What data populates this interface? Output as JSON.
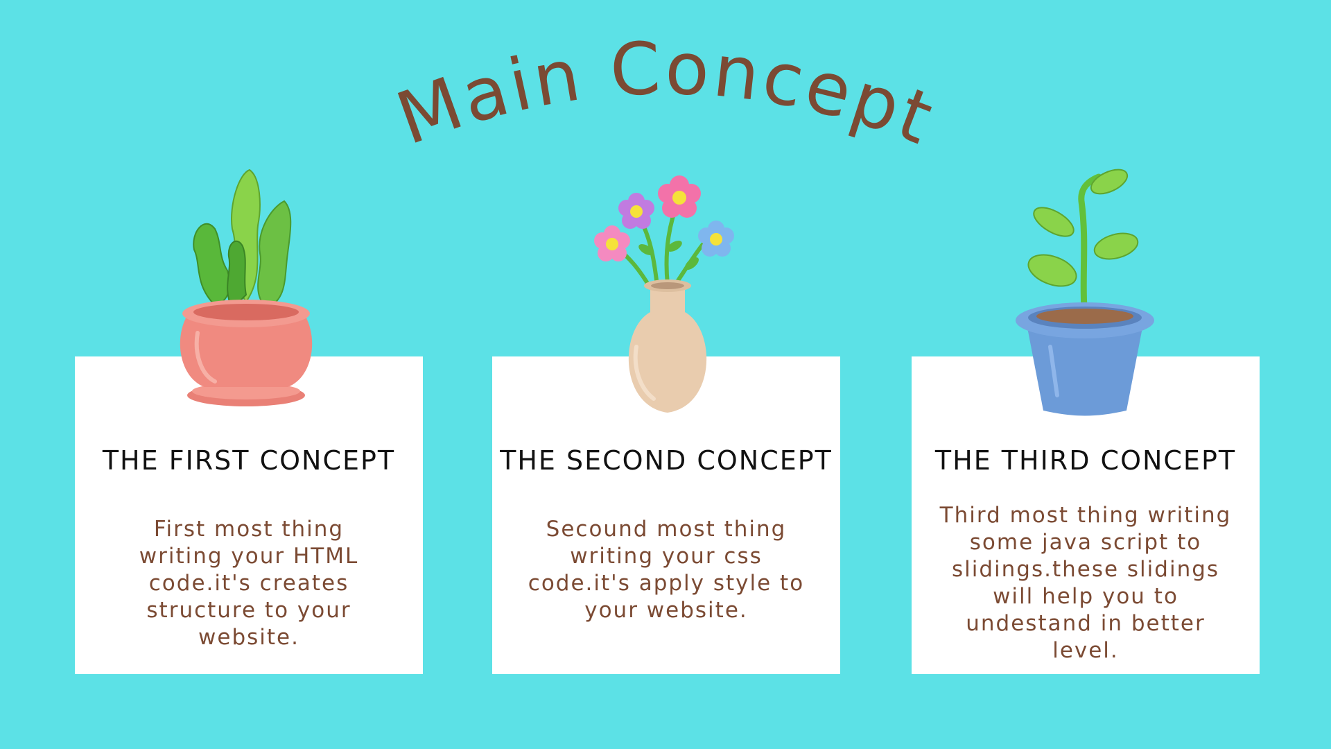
{
  "title": "Main Concept",
  "cards": [
    {
      "heading": "THE FIRST CONCEPT",
      "body": "First most thing writing your HTML code.it's creates structure to your website.",
      "illustration": "succulent-pot-icon"
    },
    {
      "heading": "THE SECOND CONCEPT",
      "body": "Secound most thing writing your css code.it's apply style to your website.",
      "illustration": "flower-vase-icon"
    },
    {
      "heading": "THE THIRD CONCEPT",
      "body": "Third most thing writing some java script to slidings.these slidings will help you to undestand in better level.",
      "illustration": "sprout-pot-icon"
    }
  ],
  "colors": {
    "background": "#5ce1e6",
    "title": "#7b4a33",
    "card": "#ffffff",
    "heading": "#111111",
    "body": "#7b4a33"
  }
}
